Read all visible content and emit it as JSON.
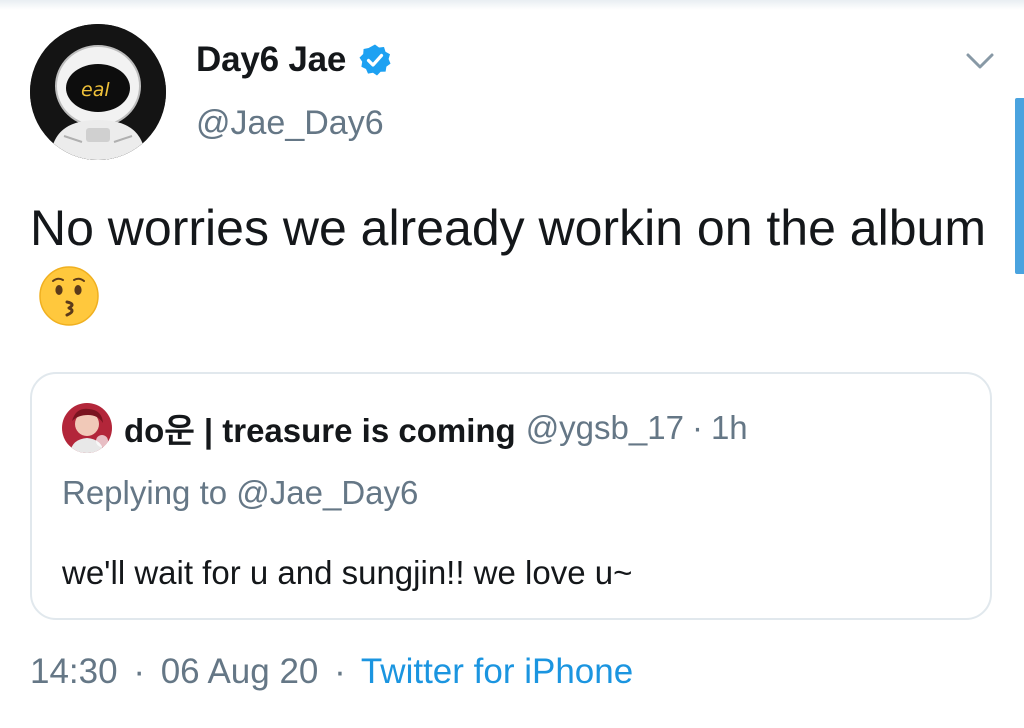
{
  "tweet": {
    "display_name": "Day6 Jae",
    "handle": "@Jae_Day6",
    "verified": true,
    "avatar_icon": "astronaut-avatar",
    "avatar_text": "eal",
    "text": "No worries we already workin on the album",
    "text_emoji": "kissing-face-emoji"
  },
  "quoted": {
    "name": "do운 | treasure is coming",
    "handle": "@ygsb_17",
    "dot": "·",
    "time": "1h",
    "replying": "Replying to @Jae_Day6",
    "text": "we'll wait for u and sungjin!! we love u~",
    "avatar_icon": "user-photo-avatar"
  },
  "footer": {
    "time": "14:30",
    "dot1": "·",
    "date": "06 Aug 20",
    "dot2": "·",
    "source": "Twitter for iPhone"
  },
  "icons": {
    "verified": "verified-badge-icon",
    "menu": "chevron-down-icon"
  },
  "colors": {
    "accent": "#1da1f2",
    "link": "#1b95e0",
    "secondary_text": "#657786",
    "border": "#e1e8ed",
    "scroll_indicator": "#4aa3df"
  }
}
